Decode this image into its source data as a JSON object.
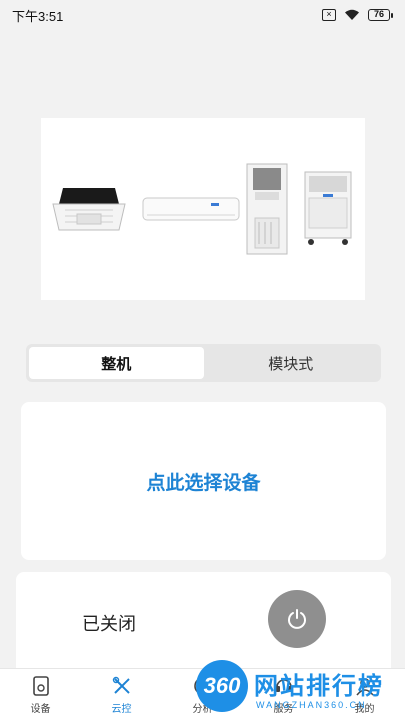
{
  "status_bar": {
    "time": "下午3:51",
    "battery": "76"
  },
  "segment": {
    "tab_whole": "整机",
    "tab_module": "模块式"
  },
  "device_select": {
    "label": "点此选择设备"
  },
  "power": {
    "state_label": "已关闭"
  },
  "nav": {
    "items": [
      {
        "label": "设备",
        "icon": "device-icon"
      },
      {
        "label": "云控",
        "icon": "cloud-control-icon"
      },
      {
        "label": "分析",
        "icon": "analysis-icon"
      },
      {
        "label": "服务",
        "icon": "service-icon"
      },
      {
        "label": "我的",
        "icon": "profile-icon"
      }
    ]
  },
  "watermark": {
    "logo_text": "360",
    "title": "网站排行榜",
    "subtitle": "WANGZHAN360.CN"
  },
  "colors": {
    "accent": "#1d83d4",
    "background": "#f2f2f2",
    "power_button": "#8f8f8f"
  }
}
